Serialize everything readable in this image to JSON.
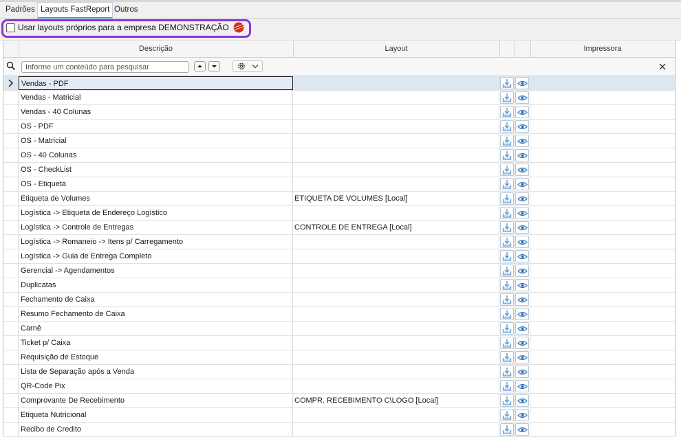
{
  "tabs": [
    {
      "label": "Padrões",
      "active": false
    },
    {
      "label": "Layouts FastReport",
      "active": true
    },
    {
      "label": "Outros",
      "active": false
    }
  ],
  "option": {
    "label": "Usar layouts próprios para a empresa DEMONSTRAÇÃO",
    "checked": false,
    "badge_icon": "novo-badge-icon"
  },
  "grid": {
    "columns": [
      "Descrição",
      "Layout",
      "",
      "",
      "Impressora"
    ],
    "search_placeholder": "Informe um conteúdo para pesquisar",
    "icons": {
      "row_action_1": "download-tray-icon",
      "row_action_2": "eye-icon",
      "search": "magnifier-icon",
      "settings": "gear-icon",
      "clear": "close-icon"
    },
    "rows": [
      {
        "descricao": "Vendas - PDF",
        "layout": "",
        "selected": true
      },
      {
        "descricao": "Vendas - Matricial",
        "layout": ""
      },
      {
        "descricao": "Vendas - 40 Colunas",
        "layout": ""
      },
      {
        "descricao": "OS - PDF",
        "layout": ""
      },
      {
        "descricao": "OS - Matricial",
        "layout": ""
      },
      {
        "descricao": "OS - 40 Colunas",
        "layout": ""
      },
      {
        "descricao": "OS - CheckList",
        "layout": ""
      },
      {
        "descricao": "OS - Etiqueta",
        "layout": ""
      },
      {
        "descricao": "Etiqueta de Volumes",
        "layout": "ETIQUETA DE VOLUMES   [Local]"
      },
      {
        "descricao": "Logística -> Etiqueta de Endereço Logístico",
        "layout": ""
      },
      {
        "descricao": "Logística -> Controle de Entregas",
        "layout": "CONTROLE DE ENTREGA   [Local]"
      },
      {
        "descricao": "Logística -> Romaneio -> Itens p/ Carregamento",
        "layout": ""
      },
      {
        "descricao": "Logística -> Guia de Entrega Completo",
        "layout": ""
      },
      {
        "descricao": "Gerencial -> Agendamentos",
        "layout": ""
      },
      {
        "descricao": "Duplicatas",
        "layout": ""
      },
      {
        "descricao": "Fechamento de Caixa",
        "layout": ""
      },
      {
        "descricao": "Resumo Fechamento de Caixa",
        "layout": ""
      },
      {
        "descricao": "Carnê",
        "layout": ""
      },
      {
        "descricao": "Ticket p/ Caixa",
        "layout": ""
      },
      {
        "descricao": "Requisição de Estoque",
        "layout": ""
      },
      {
        "descricao": "Lista de Separação após a Venda",
        "layout": ""
      },
      {
        "descricao": "QR-Code Pix",
        "layout": ""
      },
      {
        "descricao": "Comprovante De Recebimento",
        "layout": "COMPR. RECEBIMENTO C\\LOGO   [Local]"
      },
      {
        "descricao": "Etiqueta Nutricional",
        "layout": ""
      },
      {
        "descricao": "Recibo de Credito",
        "layout": ""
      }
    ]
  }
}
